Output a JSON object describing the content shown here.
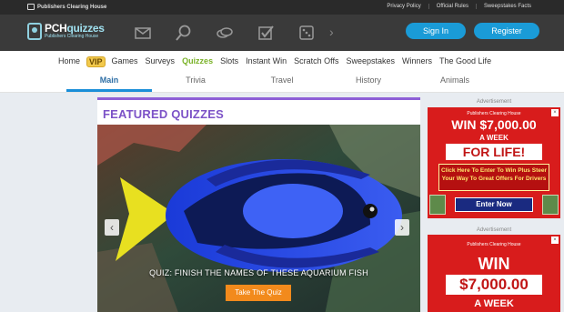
{
  "topbar": {
    "brand": "Publishers Clearing House",
    "links": [
      "Privacy Policy",
      "Official Rules",
      "Sweepstakes Facts"
    ]
  },
  "header": {
    "logo_pch": "PCH",
    "logo_quizzes": "quizzes",
    "logo_tagline": "Publishers Clearing House",
    "icons": [
      "envelope-icon",
      "magnifier-icon",
      "cash-icon",
      "checkmark-icon",
      "dice-icon"
    ],
    "sign_in": "Sign In",
    "register": "Register"
  },
  "mainnav": {
    "items": [
      "Home",
      "VIP",
      "Games",
      "Surveys",
      "Quizzes",
      "Slots",
      "Instant Win",
      "Scratch Offs",
      "Sweepstakes",
      "Winners",
      "The Good Life"
    ],
    "active": "Quizzes"
  },
  "subnav": {
    "tabs": [
      "Main",
      "Trivia",
      "Travel",
      "History",
      "Animals"
    ],
    "active": "Main"
  },
  "featured": {
    "title": "FEATURED QUIZZES",
    "caption": "QUIZ: FINISH THE NAMES OF THESE AQUARIUM FISH",
    "button": "Take The Quiz",
    "prev_icon": "chevron-left-icon",
    "next_icon": "chevron-right-icon"
  },
  "ads": [
    {
      "label": "Advertisement",
      "brand": "Publishers Clearing House",
      "line1": "WIN $7,000.00",
      "line2": "A WEEK",
      "line3": "FOR LIFE!",
      "offer": "Click Here To Enter To Win Plus Steer Your Way To Great Offers For Drivers",
      "cta": "Enter Now"
    },
    {
      "label": "Advertisement",
      "brand": "Publishers Clearing House",
      "line1": "WIN",
      "line2": "$7,000.00",
      "line3": "A WEEK"
    }
  ],
  "colors": {
    "accent_blue": "#1a9bd7",
    "quiz_purple": "#7c52c7",
    "active_green": "#7ab228",
    "button_orange": "#f28a1c",
    "ad_red": "#d81c1c"
  }
}
